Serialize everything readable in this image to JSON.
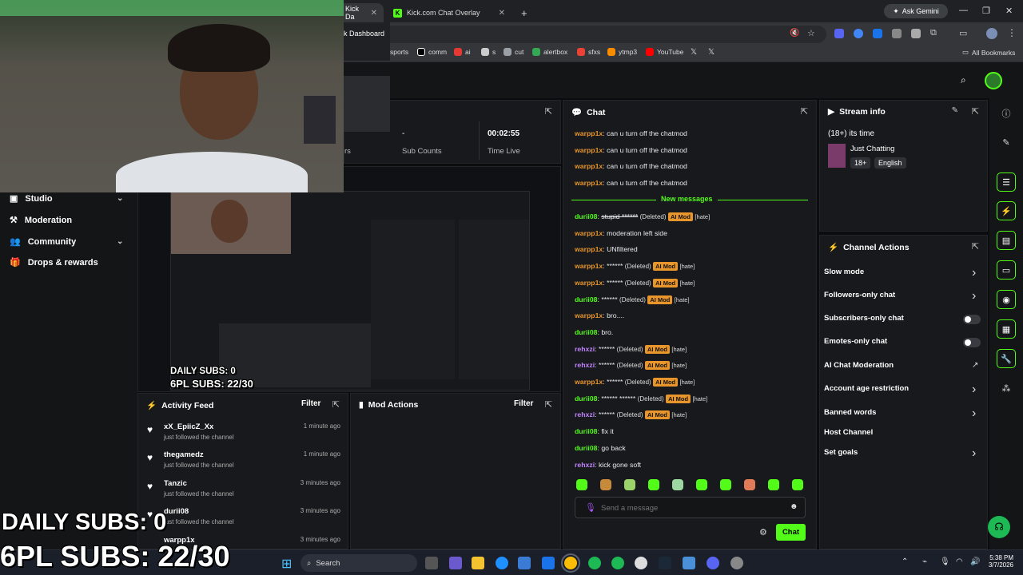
{
  "browser": {
    "tabs": [
      {
        "label": "Kick Da",
        "active": true
      },
      {
        "label": "Kick.com Chat Overlay",
        "active": false
      }
    ],
    "new_tab": "+",
    "gemini": "Ask Gemini",
    "bookmarks": [
      {
        "label": "sports",
        "color": "#e23b3b"
      },
      {
        "label": "comm",
        "color": "#ffffff"
      },
      {
        "label": "ai",
        "color": "#e53935"
      },
      {
        "label": "s",
        "color": "#cccccc"
      },
      {
        "label": "cut",
        "color": "#9aa0a6"
      },
      {
        "label": "alertbox",
        "color": "#34a853"
      },
      {
        "label": "sfxs",
        "color": "#ea4335"
      },
      {
        "label": "ytmp3",
        "color": "#fb8c00"
      },
      {
        "label": "YouTube",
        "color": "#ff0000"
      },
      {
        "label": "",
        "color": "#ffffff"
      },
      {
        "label": "",
        "color": "#ffffff"
      }
    ],
    "all_bookmarks": "All Bookmarks"
  },
  "dashboard": {
    "tooltip": "k Dashboard",
    "stats": [
      {
        "value": "",
        "label": "rs"
      },
      {
        "value": "-",
        "label": "Sub Counts"
      },
      {
        "value": "00:02:55",
        "label": "Time Live"
      }
    ]
  },
  "sidebar": {
    "items": [
      {
        "label": "Studio",
        "icon": "studio-icon",
        "chevron": true
      },
      {
        "label": "Moderation",
        "icon": "moderation-icon",
        "chevron": false
      },
      {
        "label": "Community",
        "icon": "community-icon",
        "chevron": true
      },
      {
        "label": "Drops & rewards",
        "icon": "drops-icon",
        "chevron": false
      }
    ]
  },
  "preview_overlay": {
    "daily": "DAILY SUBS: 0",
    "goal": "6PL SUBS: 22/30"
  },
  "activity_feed": {
    "title": "Activity Feed",
    "filter": "Filter",
    "items": [
      {
        "name": "xX_EpiicZ_Xx",
        "action": "just followed the channel",
        "time": "1 minute ago"
      },
      {
        "name": "thegamedz",
        "action": "just followed the channel",
        "time": "1 minute ago"
      },
      {
        "name": "Tanzic",
        "action": "just followed the channel",
        "time": "3 minutes ago"
      },
      {
        "name": "durii08",
        "action": "just followed the channel",
        "time": "3 minutes ago"
      },
      {
        "name": "warpp1x",
        "action": "",
        "time": "3 minutes ago"
      }
    ]
  },
  "mod_actions": {
    "title": "Mod Actions",
    "filter": "Filter"
  },
  "chat": {
    "title": "Chat",
    "new_messages": "New messages",
    "old": [
      {
        "user": "warpp1x",
        "text": ": can u turn off the chatmod"
      },
      {
        "user": "warpp1x",
        "text": ": can u turn off the chatmod"
      },
      {
        "user": "warpp1x",
        "text": ": can u turn off the chatmod"
      },
      {
        "user": "warpp1x",
        "text": ": can u turn off the chatmod"
      }
    ],
    "messages": [
      {
        "user": "durii08",
        "color": "#53fc18",
        "text": "stupid ******",
        "deleted": true,
        "strike": true
      },
      {
        "user": "warpp1x",
        "color": "#e8952b",
        "text": "moderation left side"
      },
      {
        "user": "warpp1x",
        "color": "#e8952b",
        "text": "UNfiltered"
      },
      {
        "user": "warpp1x",
        "color": "#e8952b",
        "text": "******",
        "deleted": true
      },
      {
        "user": "warpp1x",
        "color": "#e8952b",
        "text": "******",
        "deleted": true
      },
      {
        "user": "durii08",
        "color": "#53fc18",
        "text": "******",
        "deleted": true
      },
      {
        "user": "warpp1x",
        "color": "#e8952b",
        "text": "bro...."
      },
      {
        "user": "durii08",
        "color": "#53fc18",
        "text": "bro."
      },
      {
        "user": "rehxzi",
        "color": "#c084fc",
        "text": "******",
        "deleted": true
      },
      {
        "user": "rehxzi",
        "color": "#c084fc",
        "text": "******",
        "deleted": true
      },
      {
        "user": "warpp1x",
        "color": "#e8952b",
        "text": "******",
        "deleted": true
      },
      {
        "user": "durii08",
        "color": "#53fc18",
        "text": "****** ******",
        "deleted": true
      },
      {
        "user": "rehxzi",
        "color": "#c084fc",
        "text": "******",
        "deleted": true
      },
      {
        "user": "durii08",
        "color": "#53fc18",
        "text": "fix it"
      },
      {
        "user": "durii08",
        "color": "#53fc18",
        "text": "go back"
      },
      {
        "user": "rehxzi",
        "color": "#c084fc",
        "text": "kick gone soft"
      }
    ],
    "deleted_label": "(Deleted)",
    "ai_mod_label": "AI Mod",
    "hate_label": "[hate]",
    "placeholder": "Send a message",
    "send": "Chat"
  },
  "stream_info": {
    "title": "Stream info",
    "stream_title": "(18+) its time",
    "category": "Just Chatting",
    "tags": [
      "18+",
      "English"
    ]
  },
  "channel_actions": {
    "title": "Channel Actions",
    "items": [
      {
        "label": "Slow mode",
        "control": "chevron"
      },
      {
        "label": "Followers-only chat",
        "control": "chevron"
      },
      {
        "label": "Subscribers-only chat",
        "control": "toggle"
      },
      {
        "label": "Emotes-only chat",
        "control": "toggle"
      },
      {
        "label": "AI Chat Moderation",
        "control": "external"
      },
      {
        "label": "Account age restriction",
        "control": "chevron"
      },
      {
        "label": "Banned words",
        "control": "chevron"
      },
      {
        "label": "Host Channel",
        "control": "none"
      },
      {
        "label": "Set goals",
        "control": "chevron"
      }
    ]
  },
  "overlay": {
    "daily": "DAILY SUBS: 0",
    "goal": "6PL SUBS: 22/30"
  },
  "taskbar": {
    "search": "Search",
    "time": "5:38 PM",
    "date": "3/7/2026"
  },
  "colors": {
    "kick_green": "#53fc18",
    "ai_mod": "#e8952b"
  }
}
